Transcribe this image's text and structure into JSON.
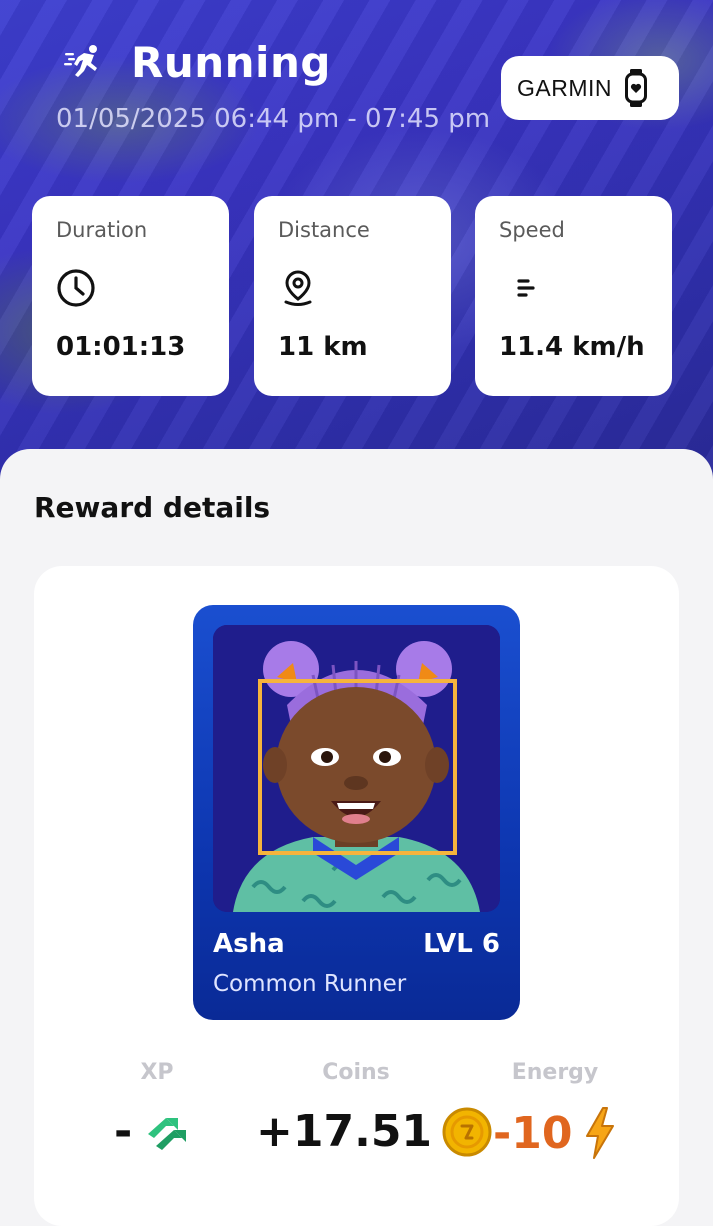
{
  "activity": {
    "title": "Running",
    "date_range": "01/05/2025 06:44 pm - 07:45 pm",
    "icon": "running-icon"
  },
  "device": {
    "label": "GARMIN",
    "icon": "smartwatch-icon"
  },
  "stats": [
    {
      "label": "Duration",
      "value": "01:01:13",
      "icon": "clock-icon"
    },
    {
      "label": "Distance",
      "value": "11 km",
      "icon": "location-pin-icon"
    },
    {
      "label": "Speed",
      "value": "11.4 km/h",
      "icon": "speed-lines-icon"
    }
  ],
  "rewards": {
    "section_title": "Reward details",
    "character": {
      "name": "Asha",
      "level": "LVL 6",
      "class": "Common Runner"
    },
    "items": [
      {
        "label": "XP",
        "value": "-",
        "icon": "double-chevron-up-icon",
        "color": "#111111"
      },
      {
        "label": "Coins",
        "value": "+17.51",
        "icon": "coin-icon",
        "color": "#111111"
      },
      {
        "label": "Energy",
        "value": "-10",
        "icon": "lightning-icon",
        "color": "#e0661f"
      }
    ]
  },
  "colors": {
    "hero_blue": "#3a34c4",
    "card_blue": "#1a4fd0",
    "energy_orange": "#e0661f",
    "coin_gold": "#f2b400",
    "xp_green": "#2ec27e"
  }
}
